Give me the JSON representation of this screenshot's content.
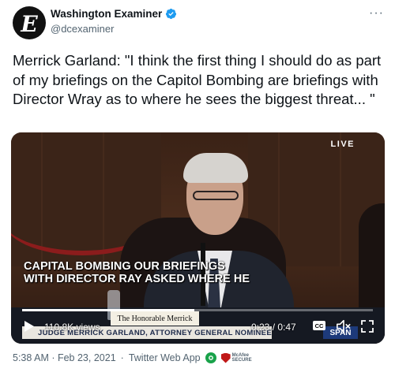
{
  "author": {
    "name": "Washington Examiner",
    "handle": "@dcexaminer",
    "avatar_letter": "E",
    "verified": true
  },
  "tweet": {
    "text": "Merrick Garland: \"I think the first thing I should do as part of my briefings on the Capitol Bombing are briefings with Director Wray as to where he sees the biggest threat... \""
  },
  "video": {
    "live_label": "LIVE",
    "caption": "CAPITAL BOMBING OUR BRIEFINGS\nWITH DIRECTOR RAY ASKED WHERE HE",
    "nameplate": "The Honorable  Merrick",
    "lower_third": "JUDGE MERRICK GARLAND, ATTORNEY GENERAL NOMINEE",
    "network": "SPAN",
    "views": "110.8K views",
    "time": "0:23 / 0:47",
    "progress": 0.49,
    "cc_label": "CC"
  },
  "footer": {
    "timestamp": "5:38 AM · Feb 23, 2021",
    "separator": "·",
    "source": "Twitter Web App",
    "mcafee_line1": "McAfee",
    "mcafee_line2": "SECURE"
  },
  "colors": {
    "text": "#0f1419",
    "muted": "#536471",
    "verified": "#1d9bf0"
  }
}
